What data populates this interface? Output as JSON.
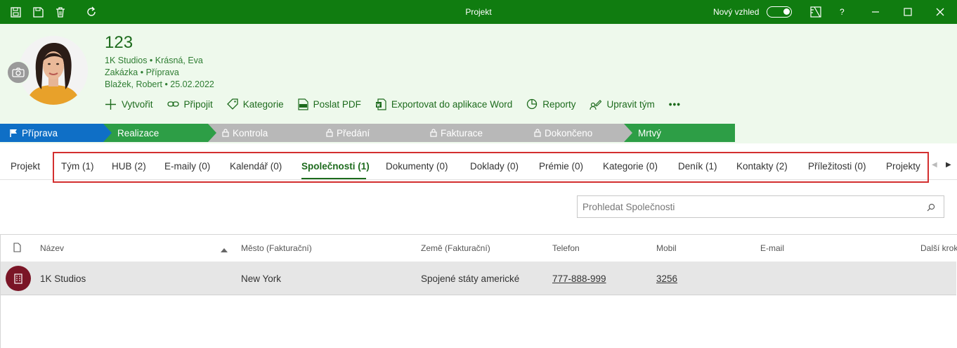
{
  "window": {
    "title": "Projekt",
    "new_look_label": "Nový vzhled",
    "help_label": "?"
  },
  "header": {
    "title": "123",
    "line1": "1K Studios • Krásná, Eva",
    "line2": "Zakázka • Příprava",
    "line3": "Blažek, Robert • 25.02.2022"
  },
  "commands": [
    {
      "label": "Vytvořit",
      "icon": "plus-icon"
    },
    {
      "label": "Připojit",
      "icon": "link-icon"
    },
    {
      "label": "Kategorie",
      "icon": "tag-icon"
    },
    {
      "label": "Poslat PDF",
      "icon": "pdf-icon"
    },
    {
      "label": "Exportovat do aplikace Word",
      "icon": "word-icon"
    },
    {
      "label": "Reporty",
      "icon": "pie-chart-icon"
    },
    {
      "label": "Upravit tým",
      "icon": "edit-team-icon"
    },
    {
      "label": "•••",
      "icon": "more-icon"
    }
  ],
  "stages": [
    {
      "label": "Příprava",
      "color": "#0f6fc6",
      "state": "current"
    },
    {
      "label": "Realizace",
      "color": "#2d9e46",
      "state": "open"
    },
    {
      "label": "Kontrola",
      "color": "#b8b8b8",
      "state": "locked"
    },
    {
      "label": "Předání",
      "color": "#b8b8b8",
      "state": "locked"
    },
    {
      "label": "Fakturace",
      "color": "#b8b8b8",
      "state": "locked"
    },
    {
      "label": "Dokončeno",
      "color": "#b8b8b8",
      "state": "locked"
    },
    {
      "label": "Mrtvý",
      "color": "#2d9e46",
      "state": "open"
    }
  ],
  "tabs": [
    {
      "label": "Projekt"
    },
    {
      "label": "Tým (1)"
    },
    {
      "label": "HUB (2)"
    },
    {
      "label": "E-maily (0)"
    },
    {
      "label": "Kalendář (0)"
    },
    {
      "label": "Společnosti (1)",
      "active": true
    },
    {
      "label": "Dokumenty (0)"
    },
    {
      "label": "Doklady (0)"
    },
    {
      "label": "Prémie (0)"
    },
    {
      "label": "Kategorie (0)"
    },
    {
      "label": "Deník (1)"
    },
    {
      "label": "Kontakty (2)"
    },
    {
      "label": "Příležitosti (0)"
    },
    {
      "label": "Projekty"
    }
  ],
  "search": {
    "placeholder": "Prohledat Společnosti",
    "value": ""
  },
  "table": {
    "columns": [
      "Název",
      "Město (Fakturační)",
      "Země (Fakturační)",
      "Telefon",
      "Mobil",
      "E-mail",
      "Další krok"
    ],
    "sort": {
      "column": "Název",
      "direction": "ascending"
    },
    "rows": [
      {
        "name": "1K Studios",
        "city": "New York",
        "country": "Spojené státy americké",
        "phone": "777-888-999",
        "mobile": "3256",
        "email": "",
        "next_step": ""
      }
    ]
  },
  "colors": {
    "titlebar": "#107c10",
    "header_bg": "#eef9ec",
    "accent": "#1d6b1d",
    "row_icon": "#7a1526",
    "highlight_frame": "#d32f2f"
  }
}
